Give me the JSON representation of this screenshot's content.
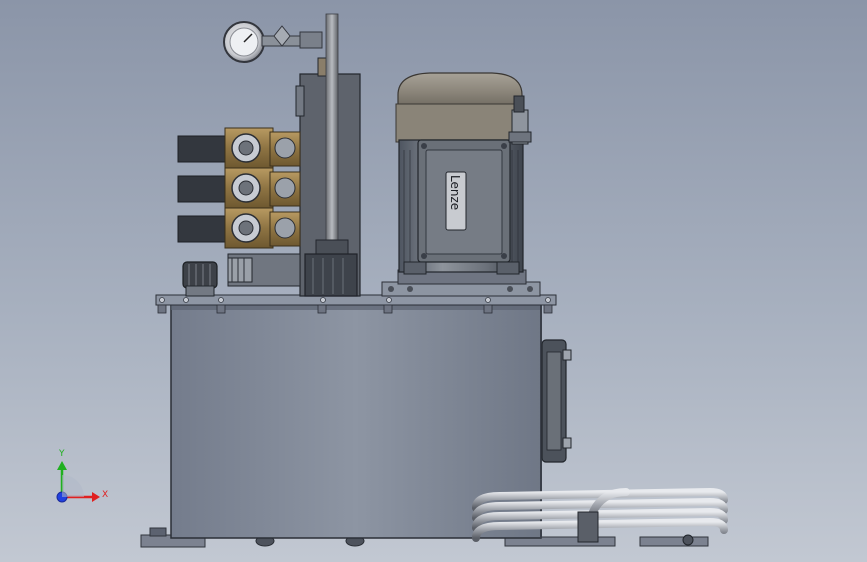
{
  "viewport": {
    "background_top": "#8b95a8",
    "background_bottom": "#c2c8d2"
  },
  "motor": {
    "brand_label": "Lenze"
  },
  "triad": {
    "x_label": "X",
    "y_label": "Y",
    "x_color": "#e02020",
    "y_color": "#20b020",
    "z_color": "#2040e0"
  },
  "components": {
    "tank": "reservoir-tank",
    "motor": "electric-motor",
    "gauge": "pressure-gauge",
    "valves": "solenoid-valve-stack",
    "hose": "coiled-hose",
    "sight_glass": "level-sight-glass",
    "filler": "filler-breather-cap",
    "return_pipe": "return-pipe"
  }
}
